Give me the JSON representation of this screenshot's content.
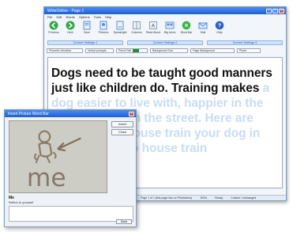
{
  "main_window": {
    "title": "WriteOnline - Page 1",
    "menu": [
      "File",
      "Edit",
      "Words",
      "Options",
      "Tools",
      "Help"
    ],
    "toolbar": [
      {
        "label": "Previous",
        "icon": "green-left-arrow-icon",
        "color": "#2fa64a"
      },
      {
        "label": "Next",
        "icon": "green-right-arrow-icon",
        "color": "#2fa64a"
      },
      {
        "label": "Save",
        "icon": "save-document-icon",
        "color": "#5b8fd6"
      },
      {
        "label": "Pictures",
        "icon": "pictures-icon",
        "color": "#5b8fd6"
      },
      {
        "label": "Speakright",
        "icon": "speak-document-icon",
        "color": "#5b8fd6"
      },
      {
        "label": "Columns",
        "icon": "columns-icon",
        "color": "#8aa0bd"
      },
      {
        "label": "Read Aloud",
        "icon": "read-aloud-icon",
        "color": "#8aa0bd"
      },
      {
        "label": "Big Icons",
        "icon": "big-icons-icon",
        "color": "#5b8fd6"
      },
      {
        "label": "Word Bar",
        "icon": "green-circle-icon",
        "color": "#3cb54a"
      },
      {
        "label": "Mail",
        "icon": "mail-icon",
        "color": "#4a90e2"
      },
      {
        "label": "Help",
        "icon": "help-globe-icon",
        "color": "#2c5fc7"
      }
    ],
    "settings": [
      "Current Settings 1",
      "Current Settings 2",
      "Current Settings 3"
    ],
    "options": [
      {
        "label": "Phonetic Wordbar"
      },
      {
        "label": "Verbal prompts"
      },
      {
        "label": "Pencil Tab"
      },
      {
        "label": "Background Tool"
      },
      {
        "label": "Page Background"
      },
      {
        "label": "Photo"
      }
    ],
    "document": {
      "text_dark": "Dogs need to be taught good manners just like children do. Training makes",
      "text_faded": " a dog easier to live with, happier in the house, safer on the street. Here are some tips to house train your dog in the best way to house train"
    },
    "status": [
      "Page 1 of 1 (this page has no Predictions)",
      "100%",
      "Ready",
      "Custom: Unchanged"
    ]
  },
  "dialog": {
    "title": "Insert Picture Word Bar",
    "buttons": [
      "Insert",
      "Close"
    ],
    "picture_word": "me",
    "word_label": "Me",
    "word_desc": "Refers to yourself",
    "close_label": "Done"
  },
  "colors": {
    "title_bar": "#1e5fd3",
    "settings_fill": "#cfe3fb",
    "faded_text": "#c9dcf3",
    "dark_text": "#111111"
  }
}
